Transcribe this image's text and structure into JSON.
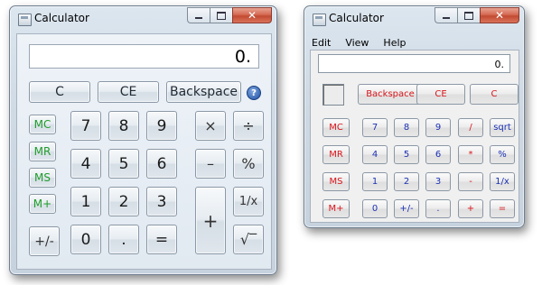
{
  "colors": {
    "memory_green": "#1f9c2a",
    "classic_red": "#d8141a",
    "classic_blue": "#1c31b4",
    "close_red": "#c24b32"
  },
  "vista_calc": {
    "title": "Calculator",
    "display": "0.",
    "icons": {
      "app": "calculator-icon",
      "help": "help-icon"
    },
    "help_glyph": "?",
    "window_controls": {
      "close": "✕"
    },
    "top_row": [
      "C",
      "CE",
      "Backspace"
    ],
    "memory": [
      "MC",
      "MR",
      "MS",
      "M+"
    ],
    "digits": {
      "seven": "7",
      "eight": "8",
      "nine": "9",
      "four": "4",
      "five": "5",
      "six": "6",
      "one": "1",
      "two": "2",
      "three": "3",
      "zero": "0"
    },
    "ops": {
      "multiply": "×",
      "divide": "÷",
      "subtract": "–",
      "percent": "%",
      "reciprocal": "1/x",
      "add": "+",
      "sqrt": "√‾",
      "equals": "=",
      "decimal": ".",
      "sign": "+/-"
    }
  },
  "classic_calc": {
    "title": "Calculator",
    "display": "0.",
    "menu": [
      "Edit",
      "View",
      "Help"
    ],
    "window_controls": {
      "close": "✕"
    },
    "top_row": [
      "Backspace",
      "CE",
      "C"
    ],
    "rows": [
      [
        "MC",
        "7",
        "8",
        "9",
        "/",
        "sqrt"
      ],
      [
        "MR",
        "4",
        "5",
        "6",
        "*",
        "%"
      ],
      [
        "MS",
        "1",
        "2",
        "3",
        "-",
        "1/x"
      ],
      [
        "M+",
        "0",
        "+/-",
        ".",
        "+",
        "="
      ]
    ]
  }
}
